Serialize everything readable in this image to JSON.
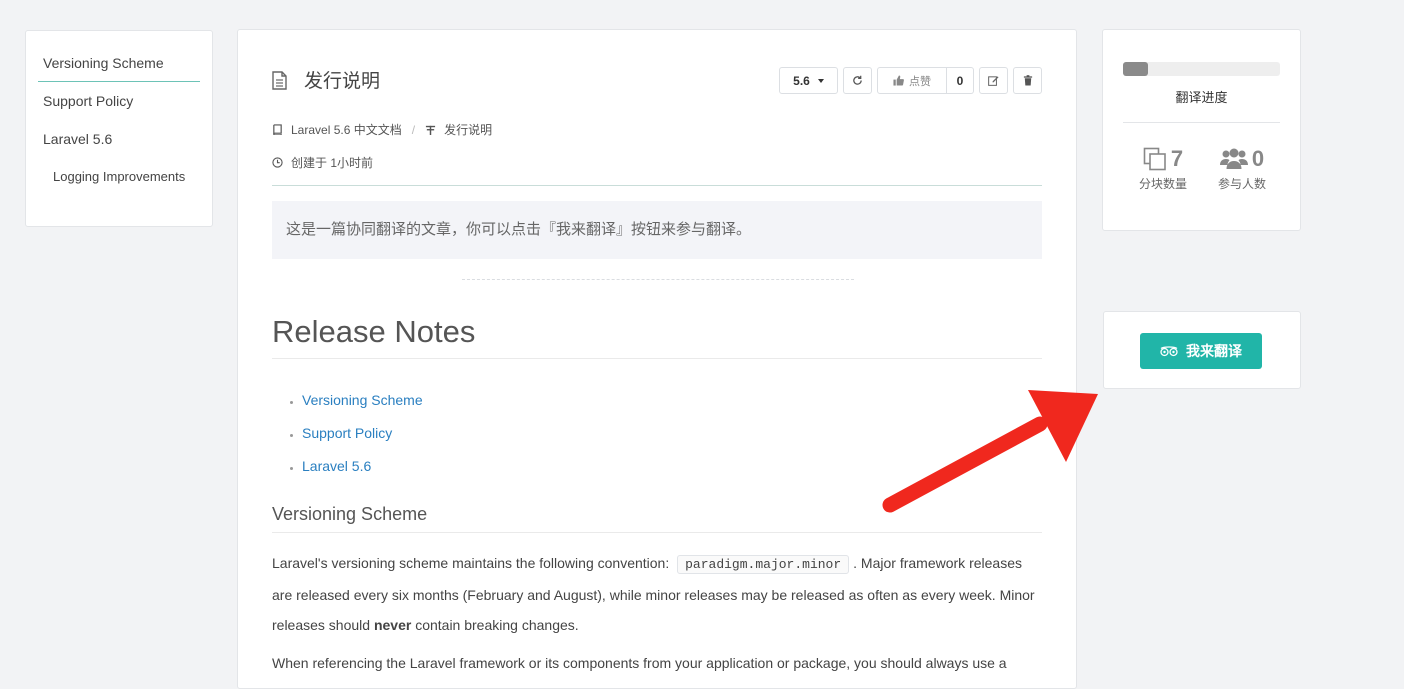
{
  "toc": {
    "items": [
      {
        "label": "Versioning Scheme"
      },
      {
        "label": "Support Policy"
      },
      {
        "label": "Laravel 5.6"
      },
      {
        "label": "Logging Improvements"
      }
    ]
  },
  "article": {
    "title": "发行说明",
    "toolbar": {
      "version": "5.6",
      "like_label": "点赞",
      "like_count": "0"
    },
    "breadcrumb": {
      "book": "Laravel 5.6 中文文档",
      "separator": "/",
      "chapter": "发行说明"
    },
    "created": "创建于 1小时前",
    "notice": "这是一篇协同翻译的文章，你可以点击『我来翻译』按钮来参与翻译。",
    "heading": "Release Notes",
    "links": [
      "Versioning Scheme",
      "Support Policy",
      "Laravel 5.6"
    ],
    "section_heading": "Versioning Scheme",
    "para1": {
      "before_code": "Laravel's versioning scheme maintains the following convention:",
      "code": "paradigm.major.minor",
      "after_code": ". Major framework releases are released every six months (February and August), while minor releases may be released as often as every week. Minor releases should",
      "bold": "never",
      "end": "contain breaking changes."
    },
    "para2": "When referencing the Laravel framework or its components from your application or package, you should always use a"
  },
  "progress": {
    "fraction": 0.16,
    "label": "翻译进度",
    "chunks_count": "7",
    "chunks_label": "分块数量",
    "participants_count": "0",
    "participants_label": "参与人数"
  },
  "translate_button": {
    "label": "我来翻译"
  },
  "colors": {
    "accent": "#21b5a8",
    "link": "#2a7fc0",
    "arrow": "#f0281e"
  }
}
